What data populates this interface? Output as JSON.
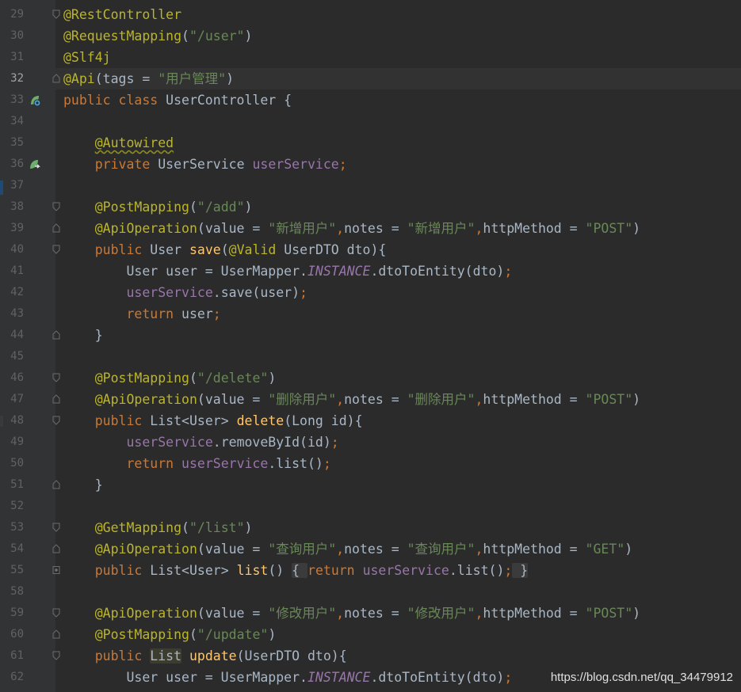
{
  "editor": {
    "watermark": "https://blog.csdn.net/qq_34479912",
    "colors": {
      "background": "#2b2b2b",
      "gutter": "#313335",
      "keyword": "#cc7832",
      "annotation": "#bbb529",
      "string": "#6a8759",
      "field": "#9876aa",
      "method": "#ffc66d",
      "text": "#a9b7c6"
    },
    "lines": [
      {
        "n": "29",
        "fold": "open",
        "tokens": [
          [
            "a",
            "@RestController"
          ]
        ]
      },
      {
        "n": "30",
        "tokens": [
          [
            "a",
            "@RequestMapping"
          ],
          [
            "t",
            "("
          ],
          [
            "s",
            "\"/user\""
          ],
          [
            "t",
            ")"
          ]
        ]
      },
      {
        "n": "31",
        "tokens": [
          [
            "a",
            "@Slf4j"
          ]
        ]
      },
      {
        "n": "32",
        "current": true,
        "fold": "close",
        "tokens": [
          [
            "a",
            "@Api"
          ],
          [
            "t",
            "(tags = "
          ],
          [
            "s",
            "\"用户管理\""
          ],
          [
            "t",
            ")"
          ]
        ]
      },
      {
        "n": "33",
        "icon": "class-bean-icon",
        "tokens": [
          [
            "k",
            "public class "
          ],
          [
            "t",
            "UserController {"
          ]
        ]
      },
      {
        "n": "34",
        "tokens": []
      },
      {
        "n": "35",
        "tokens": [
          [
            "t",
            "    "
          ],
          [
            "aw",
            "@Autowired"
          ]
        ]
      },
      {
        "n": "36",
        "icon": "navigate-bean-icon",
        "tokens": [
          [
            "t",
            "    "
          ],
          [
            "k",
            "private "
          ],
          [
            "t",
            "UserService "
          ],
          [
            "f",
            "userService"
          ],
          [
            "p",
            ";"
          ]
        ]
      },
      {
        "n": "37",
        "tokens": []
      },
      {
        "n": "38",
        "fold": "open",
        "tokens": [
          [
            "t",
            "    "
          ],
          [
            "a",
            "@PostMapping"
          ],
          [
            "t",
            "("
          ],
          [
            "s",
            "\"/add\""
          ],
          [
            "t",
            ")"
          ]
        ]
      },
      {
        "n": "39",
        "fold": "close",
        "tokens": [
          [
            "t",
            "    "
          ],
          [
            "a",
            "@ApiOperation"
          ],
          [
            "t",
            "(value = "
          ],
          [
            "s",
            "\"新增用户\""
          ],
          [
            "p",
            ","
          ],
          [
            "t",
            "notes = "
          ],
          [
            "s",
            "\"新增用户\""
          ],
          [
            "p",
            ","
          ],
          [
            "t",
            "httpMethod = "
          ],
          [
            "s",
            "\"POST\""
          ],
          [
            "t",
            ")"
          ]
        ]
      },
      {
        "n": "40",
        "fold": "open",
        "tokens": [
          [
            "t",
            "    "
          ],
          [
            "k",
            "public "
          ],
          [
            "t",
            "User "
          ],
          [
            "m",
            "save"
          ],
          [
            "t",
            "("
          ],
          [
            "a",
            "@Valid "
          ],
          [
            "t",
            "UserDTO dto){"
          ]
        ]
      },
      {
        "n": "41",
        "tokens": [
          [
            "t",
            "        User user = UserMapper."
          ],
          [
            "fi",
            "INSTANCE"
          ],
          [
            "t",
            ".dtoToEntity(dto)"
          ],
          [
            "p",
            ";"
          ]
        ]
      },
      {
        "n": "42",
        "tokens": [
          [
            "t",
            "        "
          ],
          [
            "f",
            "userService"
          ],
          [
            "t",
            ".save(user)"
          ],
          [
            "p",
            ";"
          ]
        ]
      },
      {
        "n": "43",
        "tokens": [
          [
            "t",
            "        "
          ],
          [
            "k",
            "return "
          ],
          [
            "t",
            "user"
          ],
          [
            "p",
            ";"
          ]
        ]
      },
      {
        "n": "44",
        "fold": "close",
        "tokens": [
          [
            "t",
            "    }"
          ]
        ]
      },
      {
        "n": "45",
        "tokens": []
      },
      {
        "n": "46",
        "fold": "open",
        "tokens": [
          [
            "t",
            "    "
          ],
          [
            "a",
            "@PostMapping"
          ],
          [
            "t",
            "("
          ],
          [
            "s",
            "\"/delete\""
          ],
          [
            "t",
            ")"
          ]
        ]
      },
      {
        "n": "47",
        "fold": "close",
        "tokens": [
          [
            "t",
            "    "
          ],
          [
            "a",
            "@ApiOperation"
          ],
          [
            "t",
            "(value = "
          ],
          [
            "s",
            "\"删除用户\""
          ],
          [
            "p",
            ","
          ],
          [
            "t",
            "notes = "
          ],
          [
            "s",
            "\"删除用户\""
          ],
          [
            "p",
            ","
          ],
          [
            "t",
            "httpMethod = "
          ],
          [
            "s",
            "\"POST\""
          ],
          [
            "t",
            ")"
          ]
        ]
      },
      {
        "n": "48",
        "fold": "open",
        "tokens": [
          [
            "t",
            "    "
          ],
          [
            "k",
            "public "
          ],
          [
            "t",
            "List<User> "
          ],
          [
            "m",
            "delete"
          ],
          [
            "t",
            "(Long id){"
          ]
        ]
      },
      {
        "n": "49",
        "tokens": [
          [
            "t",
            "        "
          ],
          [
            "f",
            "userService"
          ],
          [
            "t",
            ".removeById(id)"
          ],
          [
            "p",
            ";"
          ]
        ]
      },
      {
        "n": "50",
        "tokens": [
          [
            "t",
            "        "
          ],
          [
            "k",
            "return "
          ],
          [
            "f",
            "userService"
          ],
          [
            "t",
            ".list()"
          ],
          [
            "p",
            ";"
          ]
        ]
      },
      {
        "n": "51",
        "fold": "close",
        "tokens": [
          [
            "t",
            "    }"
          ]
        ]
      },
      {
        "n": "52",
        "tokens": []
      },
      {
        "n": "53",
        "fold": "open",
        "tokens": [
          [
            "t",
            "    "
          ],
          [
            "a",
            "@GetMapping"
          ],
          [
            "t",
            "("
          ],
          [
            "s",
            "\"/list\""
          ],
          [
            "t",
            ")"
          ]
        ]
      },
      {
        "n": "54",
        "fold": "close",
        "tokens": [
          [
            "t",
            "    "
          ],
          [
            "a",
            "@ApiOperation"
          ],
          [
            "t",
            "(value = "
          ],
          [
            "s",
            "\"查询用户\""
          ],
          [
            "p",
            ","
          ],
          [
            "t",
            "notes = "
          ],
          [
            "s",
            "\"查询用户\""
          ],
          [
            "p",
            ","
          ],
          [
            "t",
            "httpMethod = "
          ],
          [
            "s",
            "\"GET\""
          ],
          [
            "t",
            ")"
          ]
        ]
      },
      {
        "n": "55",
        "fold": "plus",
        "tokens": [
          [
            "t",
            "    "
          ],
          [
            "k",
            "public "
          ],
          [
            "t",
            "List<User> "
          ],
          [
            "m",
            "list"
          ],
          [
            "t",
            "() "
          ],
          [
            "hl",
            "{ "
          ],
          [
            "k",
            "return "
          ],
          [
            "f",
            "userService"
          ],
          [
            "t",
            ".list()"
          ],
          [
            "p",
            ";"
          ],
          [
            "hl",
            " }"
          ]
        ]
      },
      {
        "n": "58",
        "tokens": []
      },
      {
        "n": "59",
        "fold": "open",
        "tokens": [
          [
            "t",
            "    "
          ],
          [
            "a",
            "@ApiOperation"
          ],
          [
            "t",
            "(value = "
          ],
          [
            "s",
            "\"修改用户\""
          ],
          [
            "p",
            ","
          ],
          [
            "t",
            "notes = "
          ],
          [
            "s",
            "\"修改用户\""
          ],
          [
            "p",
            ","
          ],
          [
            "t",
            "httpMethod = "
          ],
          [
            "s",
            "\"POST\""
          ],
          [
            "t",
            ")"
          ]
        ]
      },
      {
        "n": "60",
        "fold": "close",
        "tokens": [
          [
            "t",
            "    "
          ],
          [
            "a",
            "@PostMapping"
          ],
          [
            "t",
            "("
          ],
          [
            "s",
            "\"/update\""
          ],
          [
            "t",
            ")"
          ]
        ]
      },
      {
        "n": "61",
        "fold": "open",
        "tokens": [
          [
            "t",
            "    "
          ],
          [
            "k",
            "public "
          ],
          [
            "hl2",
            "List"
          ],
          [
            "t",
            " "
          ],
          [
            "m",
            "update"
          ],
          [
            "t",
            "(UserDTO dto){"
          ]
        ]
      },
      {
        "n": "62",
        "tokens": [
          [
            "t",
            "        User user = UserMapper."
          ],
          [
            "fi",
            "INSTANCE"
          ],
          [
            "t",
            ".dtoToEntity(dto)"
          ],
          [
            "p",
            ";"
          ]
        ]
      }
    ]
  }
}
